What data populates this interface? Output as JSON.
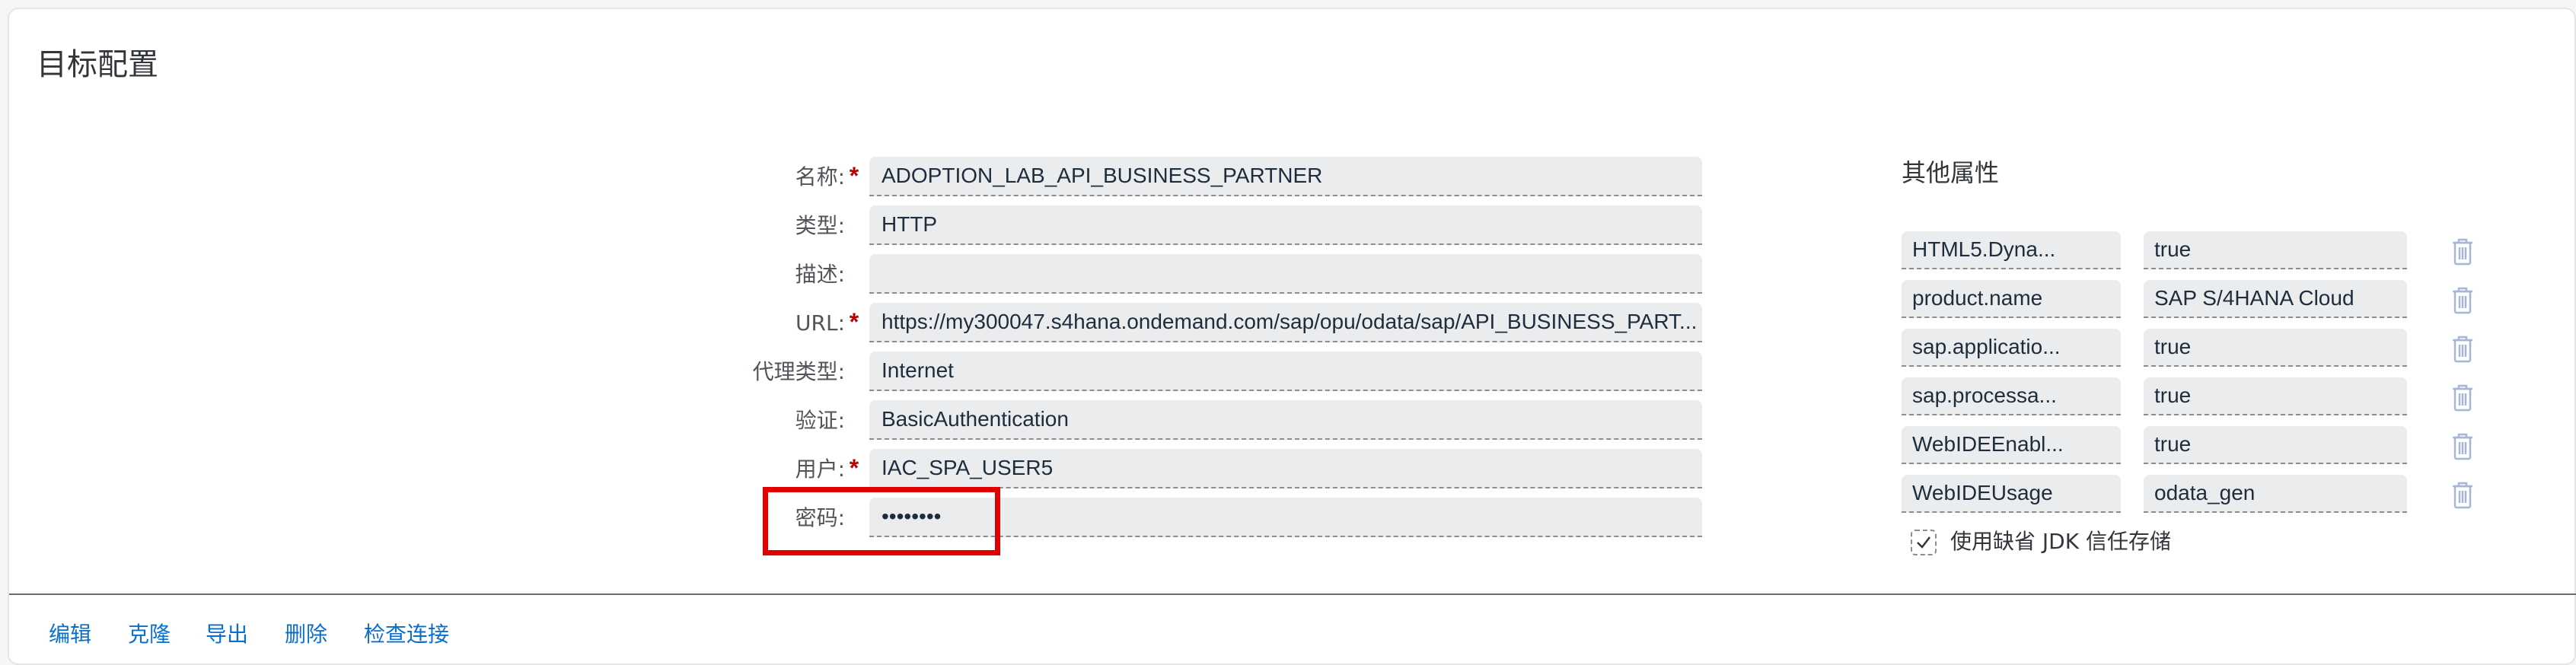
{
  "page": {
    "title": "目标配置"
  },
  "form": {
    "fields": [
      {
        "label": "名称:",
        "required": true,
        "value": "ADOPTION_LAB_API_BUSINESS_PARTNER"
      },
      {
        "label": "类型:",
        "required": false,
        "value": "HTTP"
      },
      {
        "label": "描述:",
        "required": false,
        "value": ""
      },
      {
        "label": "URL:",
        "required": true,
        "value": "https://my300047.s4hana.ondemand.com/sap/opu/odata/sap/API_BUSINESS_PART..."
      },
      {
        "label": "代理类型:",
        "required": false,
        "value": "Internet"
      },
      {
        "label": "验证:",
        "required": false,
        "value": "BasicAuthentication"
      },
      {
        "label": "用户:",
        "required": true,
        "value": "IAC_SPA_USER5"
      },
      {
        "label": "密码:",
        "required": false,
        "value": "••••••••"
      }
    ]
  },
  "other_properties": {
    "title": "其他属性",
    "items": [
      {
        "key": "HTML5.Dyna...",
        "value": "true"
      },
      {
        "key": "product.name",
        "value": "SAP S/4HANA Cloud"
      },
      {
        "key": "sap.applicatio...",
        "value": "true"
      },
      {
        "key": "sap.processa...",
        "value": "true"
      },
      {
        "key": "WebIDEEnabl...",
        "value": "true"
      },
      {
        "key": "WebIDEUsage",
        "value": "odata_gen"
      }
    ],
    "trash_icon": "trash-icon",
    "checkbox": {
      "label": "使用缺省 JDK 信任存储",
      "checked": true
    }
  },
  "footer": {
    "actions": [
      "编辑",
      "克隆",
      "导出",
      "删除",
      "检查连接"
    ]
  },
  "colors": {
    "required": "#bb0000",
    "link": "#0a6ed1",
    "highlight_box": "#e00000",
    "field_bg": "#ebecee",
    "trash": "#a7b6d3"
  }
}
